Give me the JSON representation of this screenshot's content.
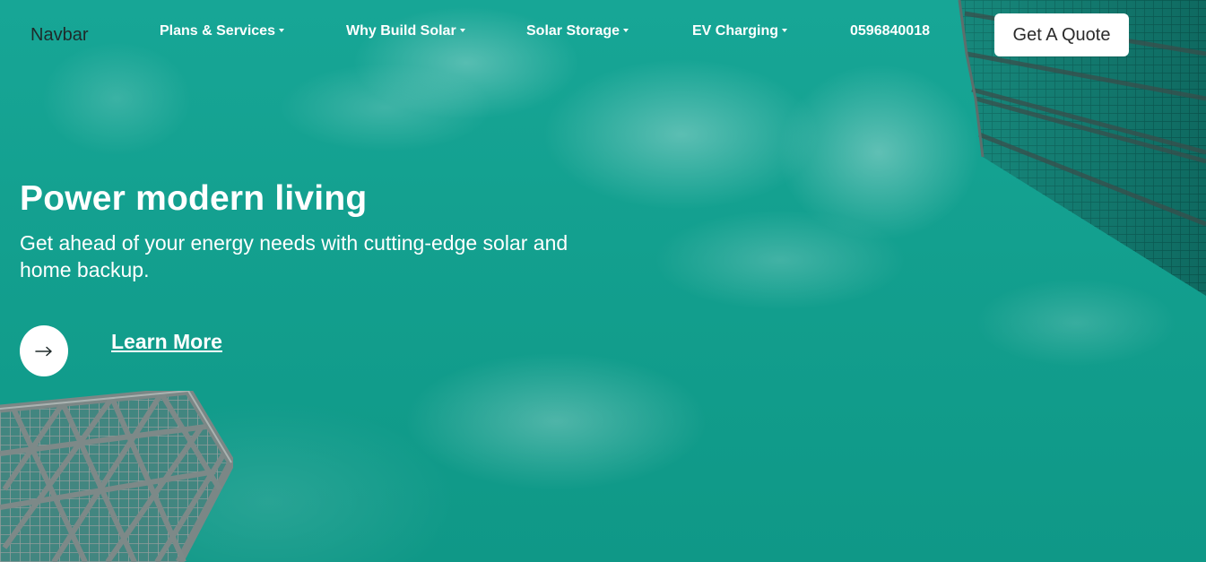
{
  "navbar": {
    "brand": "Navbar",
    "items": [
      {
        "label": "Plans & Services"
      },
      {
        "label": "Why Build Solar"
      },
      {
        "label": "Solar Storage"
      },
      {
        "label": "EV Charging"
      }
    ],
    "phone": "0596840018",
    "cta_label": "Get A Quote"
  },
  "hero": {
    "title": "Power modern living",
    "subtitle": "Get ahead of your energy needs with cutting-edge solar and home backup.",
    "learn_more": "Learn More",
    "arrow_icon": "arrow-right-icon"
  },
  "colors": {
    "background": "#129f8f",
    "text": "#ffffff",
    "button_bg": "#ffffff",
    "building_glass": "#0e7f74",
    "building_frame": "#6f7b7a"
  }
}
